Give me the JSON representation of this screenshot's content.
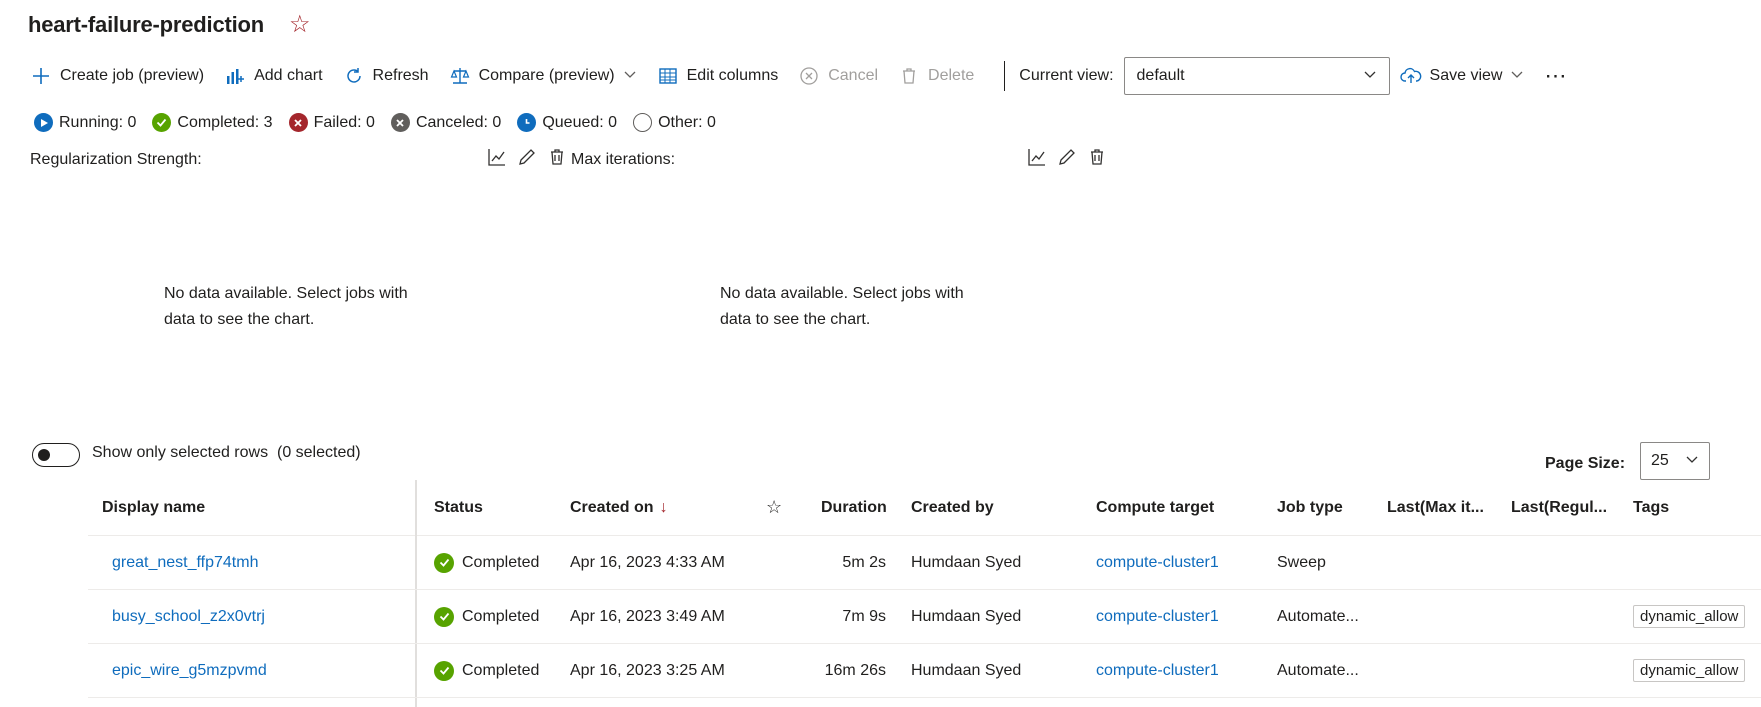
{
  "header": {
    "title": "heart-failure-prediction",
    "favorite_icon": "star-icon"
  },
  "toolbar": {
    "create_job": "Create job (preview)",
    "add_chart": "Add chart",
    "refresh": "Refresh",
    "compare": "Compare (preview)",
    "edit_columns": "Edit columns",
    "cancel": "Cancel",
    "delete": "Delete",
    "current_view_label": "Current view:",
    "current_view_value": "default",
    "save_view": "Save view",
    "more": "⋯"
  },
  "status_counts": {
    "running": "Running: 0",
    "completed": "Completed: 3",
    "failed": "Failed: 0",
    "canceled": "Canceled: 0",
    "queued": "Queued: 0",
    "other": "Other: 0"
  },
  "charts": [
    {
      "title": "Regularization Strength:",
      "no_data": "No data available. Select jobs with data to see the chart."
    },
    {
      "title": "Max iterations:",
      "no_data": "No data available. Select jobs with data to see the chart."
    }
  ],
  "selection": {
    "toggle_label": "Show only selected rows",
    "selected_count": "(0 selected)",
    "toggle_on": false
  },
  "page_size": {
    "label": "Page Size:",
    "value": "25"
  },
  "table": {
    "columns": {
      "display_name": "Display name",
      "status": "Status",
      "created_on": "Created on",
      "sort_indicator": "↓",
      "duration": "Duration",
      "created_by": "Created by",
      "compute_target": "Compute target",
      "job_type": "Job type",
      "last_max_it": "Last(Max it...",
      "last_regul": "Last(Regul...",
      "tags": "Tags"
    },
    "rows": [
      {
        "display_name": "great_nest_ffp74tmh",
        "status": "Completed",
        "created_on": "Apr 16, 2023 4:33 AM",
        "duration": "5m 2s",
        "created_by": "Humdaan Syed",
        "compute_target": "compute-cluster1",
        "job_type": "Sweep",
        "tag": ""
      },
      {
        "display_name": "busy_school_z2x0vtrj",
        "status": "Completed",
        "created_on": "Apr 16, 2023 3:49 AM",
        "duration": "7m 9s",
        "created_by": "Humdaan Syed",
        "compute_target": "compute-cluster1",
        "job_type": "Automate...",
        "tag": "dynamic_allow"
      },
      {
        "display_name": "epic_wire_g5mzpvmd",
        "status": "Completed",
        "created_on": "Apr 16, 2023 3:25 AM",
        "duration": "16m 26s",
        "created_by": "Humdaan Syed",
        "compute_target": "compute-cluster1",
        "job_type": "Automate...",
        "tag": "dynamic_allow"
      }
    ]
  },
  "colors": {
    "link": "#0f6cbd",
    "completed": "#57a300",
    "failed": "#a4262c",
    "running": "#0f6cbd",
    "canceled": "#605e5c"
  }
}
